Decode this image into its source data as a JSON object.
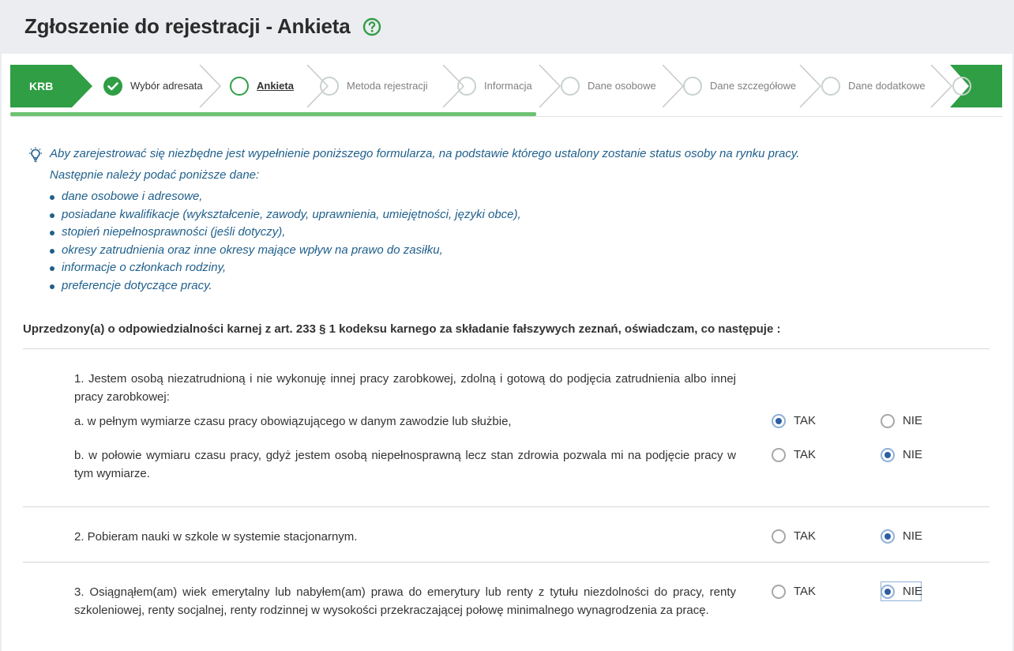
{
  "header": {
    "title": "Zgłoszenie do rejestracji - Ankieta"
  },
  "stepper": {
    "start_label": "KRB",
    "steps": [
      {
        "label": "Wybór adresata",
        "state": "done"
      },
      {
        "label": "Ankieta",
        "state": "current"
      },
      {
        "label": "Metoda rejestracji",
        "state": "todo"
      },
      {
        "label": "Informacja",
        "state": "todo"
      },
      {
        "label": "Dane osobowe",
        "state": "todo"
      },
      {
        "label": "Dane szczegółowe",
        "state": "todo"
      },
      {
        "label": "Dane dodatkowe",
        "state": "todo"
      }
    ]
  },
  "info": {
    "intro": "Aby zarejestrować się niezbędne jest wypełnienie poniższego formularza, na podstawie którego ustalony zostanie status osoby na rynku pracy.",
    "lead": "Następnie należy podać poniższe dane:",
    "items": [
      "dane osobowe i adresowe,",
      "posiadane kwalifikacje (wykształcenie, zawody, uprawnienia, umiejętności, języki obce),",
      "stopień niepełnosprawności (jeśli dotyczy),",
      "okresy zatrudnienia oraz inne okresy mające wpływ na prawo do zasiłku,",
      "informacje o członkach rodziny,",
      "preferencje dotyczące pracy."
    ]
  },
  "declaration": "Uprzedzony(a) o odpowiedzialności karnej z art. 233 § 1 kodeksu karnego za składanie fałszywych zeznań, oświadczam, co następuje :",
  "options": {
    "yes": "TAK",
    "no": "NIE"
  },
  "questions": {
    "q1": {
      "text": "1. Jestem osobą niezatrudnioną i nie wykonuję innej pracy zarobkowej, zdolną i gotową do podjęcia zatrudnienia albo innej pracy zarobkowej:",
      "a": {
        "text": "a. w pełnym wymiarze czasu pracy obowiązującego w danym zawodzie lub służbie,",
        "answer": "TAK"
      },
      "b": {
        "text": "b. w połowie wymiaru czasu pracy, gdyż jestem osobą niepełnosprawną lecz stan zdrowia pozwala mi na podjęcie pracy w tym wymiarze.",
        "answer": "NIE"
      }
    },
    "q2": {
      "text": "2. Pobieram nauki w szkole w systemie stacjonarnym.",
      "answer": "NIE"
    },
    "q3": {
      "text": "3. Osiągnąłem(am) wiek emerytalny lub nabyłem(am) prawa do emerytury lub renty z tytułu niezdolności do pracy, renty szkoleniowej, renty socjalnej, renty rodzinnej w wysokości przekraczającej połowę minimalnego wynagrodzenia za pracę.",
      "answer": "NIE"
    }
  },
  "colors": {
    "brand_green": "#2f9e44",
    "progress_green": "#6dc274",
    "info_blue": "#1f5f8b",
    "radio_selected": "#2d5ea4"
  },
  "icons": {
    "help": "question-circle-icon",
    "info": "lightbulb-icon",
    "step_done": "check-circle-icon"
  }
}
